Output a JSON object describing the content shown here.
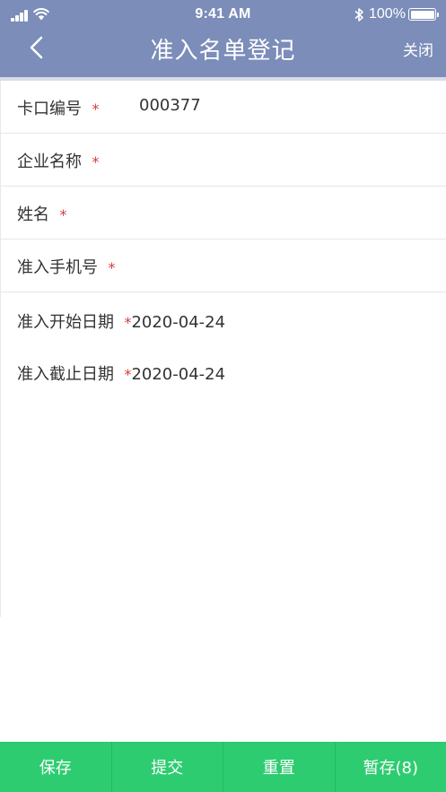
{
  "status_bar": {
    "time": "9:41 AM",
    "battery": "100%"
  },
  "nav": {
    "title": "准入名单登记",
    "close": "关闭",
    "back_icon": "chevron-left-icon"
  },
  "form": {
    "required_mark": "*",
    "fields": [
      {
        "label": "卡口编号",
        "value": "000377"
      },
      {
        "label": "企业名称",
        "value": ""
      },
      {
        "label": "姓名",
        "value": ""
      },
      {
        "label": "准入手机号",
        "value": ""
      },
      {
        "label": "准入开始日期",
        "value": "2020-04-24"
      },
      {
        "label": "准入截止日期",
        "value": "2020-04-24"
      }
    ]
  },
  "footer": {
    "buttons": [
      "保存",
      "提交",
      "重置",
      "暂存(8)"
    ]
  },
  "colors": {
    "header": "#7b8db8",
    "footer": "#2ecc71",
    "required": "#d9393b"
  }
}
